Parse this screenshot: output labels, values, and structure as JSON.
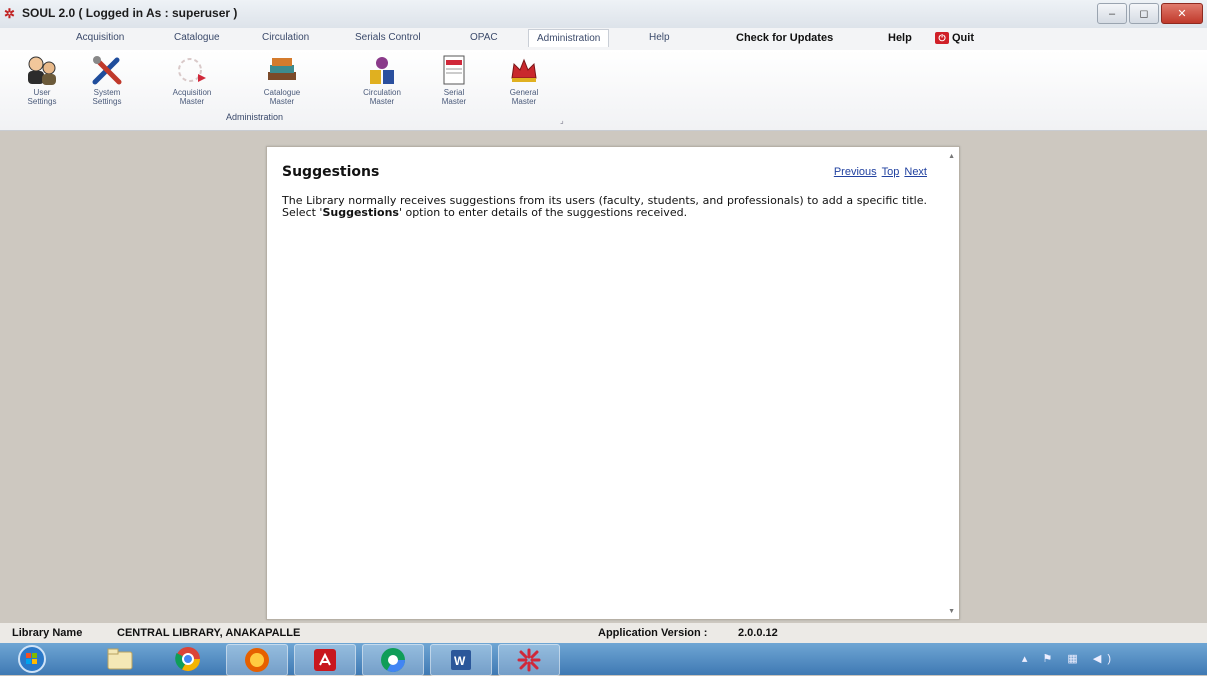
{
  "window": {
    "title": "SOUL 2.0  ( Logged in As : superuser )",
    "controls": [
      "–",
      "◻",
      "✕"
    ]
  },
  "menu": {
    "items": [
      "Acquisition",
      "Catalogue",
      "Circulation",
      "Serials Control",
      "OPAC",
      "Administration",
      "Help"
    ],
    "active": "Administration",
    "right": {
      "updates": "Check for Updates",
      "help": "Help",
      "quit": "Quit"
    }
  },
  "ribbon": {
    "buttons": [
      {
        "line1": "User",
        "line2": "Settings",
        "icon": "user-settings-icon"
      },
      {
        "line1": "System",
        "line2": "Settings",
        "icon": "system-settings-icon"
      },
      {
        "line1": "Acquisition",
        "line2": "Master",
        "icon": "acquisition-master-icon"
      },
      {
        "line1": "Catalogue",
        "line2": "Master",
        "icon": "catalogue-master-icon"
      },
      {
        "line1": "Circulation",
        "line2": "Master",
        "icon": "circulation-master-icon"
      },
      {
        "line1": "Serial",
        "line2": "Master",
        "icon": "serial-master-icon"
      },
      {
        "line1": "General",
        "line2": "Master",
        "icon": "general-master-icon"
      }
    ],
    "group_label": "Administration"
  },
  "document": {
    "title": "Suggestions",
    "nav": {
      "previous": "Previous",
      "top": "Top",
      "next": "Next"
    },
    "body_before": "The Library normally receives suggestions from its users (faculty, students, and professionals) to add a specific title.  Select '",
    "body_bold": "Suggestions",
    "body_after": "' option to enter details of the suggestions received."
  },
  "status": {
    "library_label": "Library Name",
    "library_value": "CENTRAL LIBRARY, ANAKAPALLE",
    "version_label": "Application Version :",
    "version_value": "2.0.0.12"
  },
  "taskbar": {
    "items": [
      "start-orb-icon",
      "explorer-icon",
      "chrome-icon",
      "firefox-icon",
      "pdf-reader-icon",
      "chrome-remote-icon",
      "word-icon",
      "soul-app-icon"
    ]
  },
  "colors": {
    "link": "#2242a0",
    "taskbar": "#4a86c0",
    "workspace": "#cdc8c0"
  }
}
